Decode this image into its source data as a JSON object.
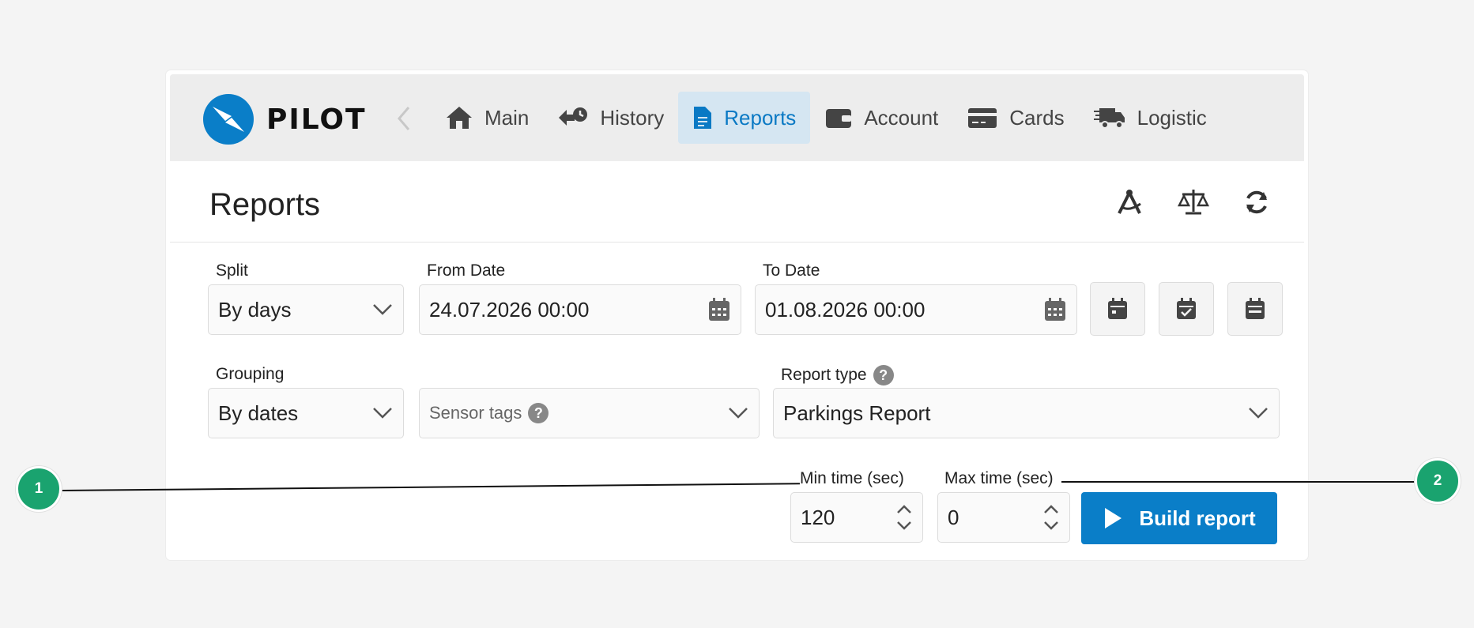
{
  "brand": {
    "name": "PILOT",
    "accent": "#0a7ec8",
    "marker_color": "#1aa36f"
  },
  "nav": {
    "items": [
      {
        "label": "Main",
        "icon": "home-icon"
      },
      {
        "label": "History",
        "icon": "history-icon"
      },
      {
        "label": "Reports",
        "icon": "document-icon",
        "active": true
      },
      {
        "label": "Account",
        "icon": "wallet-icon"
      },
      {
        "label": "Cards",
        "icon": "card-icon"
      },
      {
        "label": "Logistic",
        "icon": "truck-icon"
      }
    ]
  },
  "page": {
    "title": "Reports",
    "tools": [
      "compass-icon",
      "scales-icon",
      "refresh-icon"
    ]
  },
  "form": {
    "split": {
      "label": "Split",
      "value": "By days"
    },
    "from_date": {
      "label": "From Date",
      "value": "24.07.2026 00:00"
    },
    "to_date": {
      "label": "To Date",
      "value": "01.08.2026 00:00"
    },
    "date_presets": [
      "calendar-day-icon",
      "calendar-check-icon",
      "calendar-week-icon"
    ],
    "grouping": {
      "label": "Grouping",
      "value": "By dates"
    },
    "sensor_tags": {
      "placeholder": "Sensor tags"
    },
    "report_type": {
      "label": "Report type",
      "value": "Parkings Report"
    },
    "min_time": {
      "label": "Min time (sec)",
      "value": "120"
    },
    "max_time": {
      "label": "Max time (sec)",
      "value": "0"
    },
    "build_label": "Build report"
  },
  "annotations": {
    "marker1": "1",
    "marker2": "2"
  }
}
